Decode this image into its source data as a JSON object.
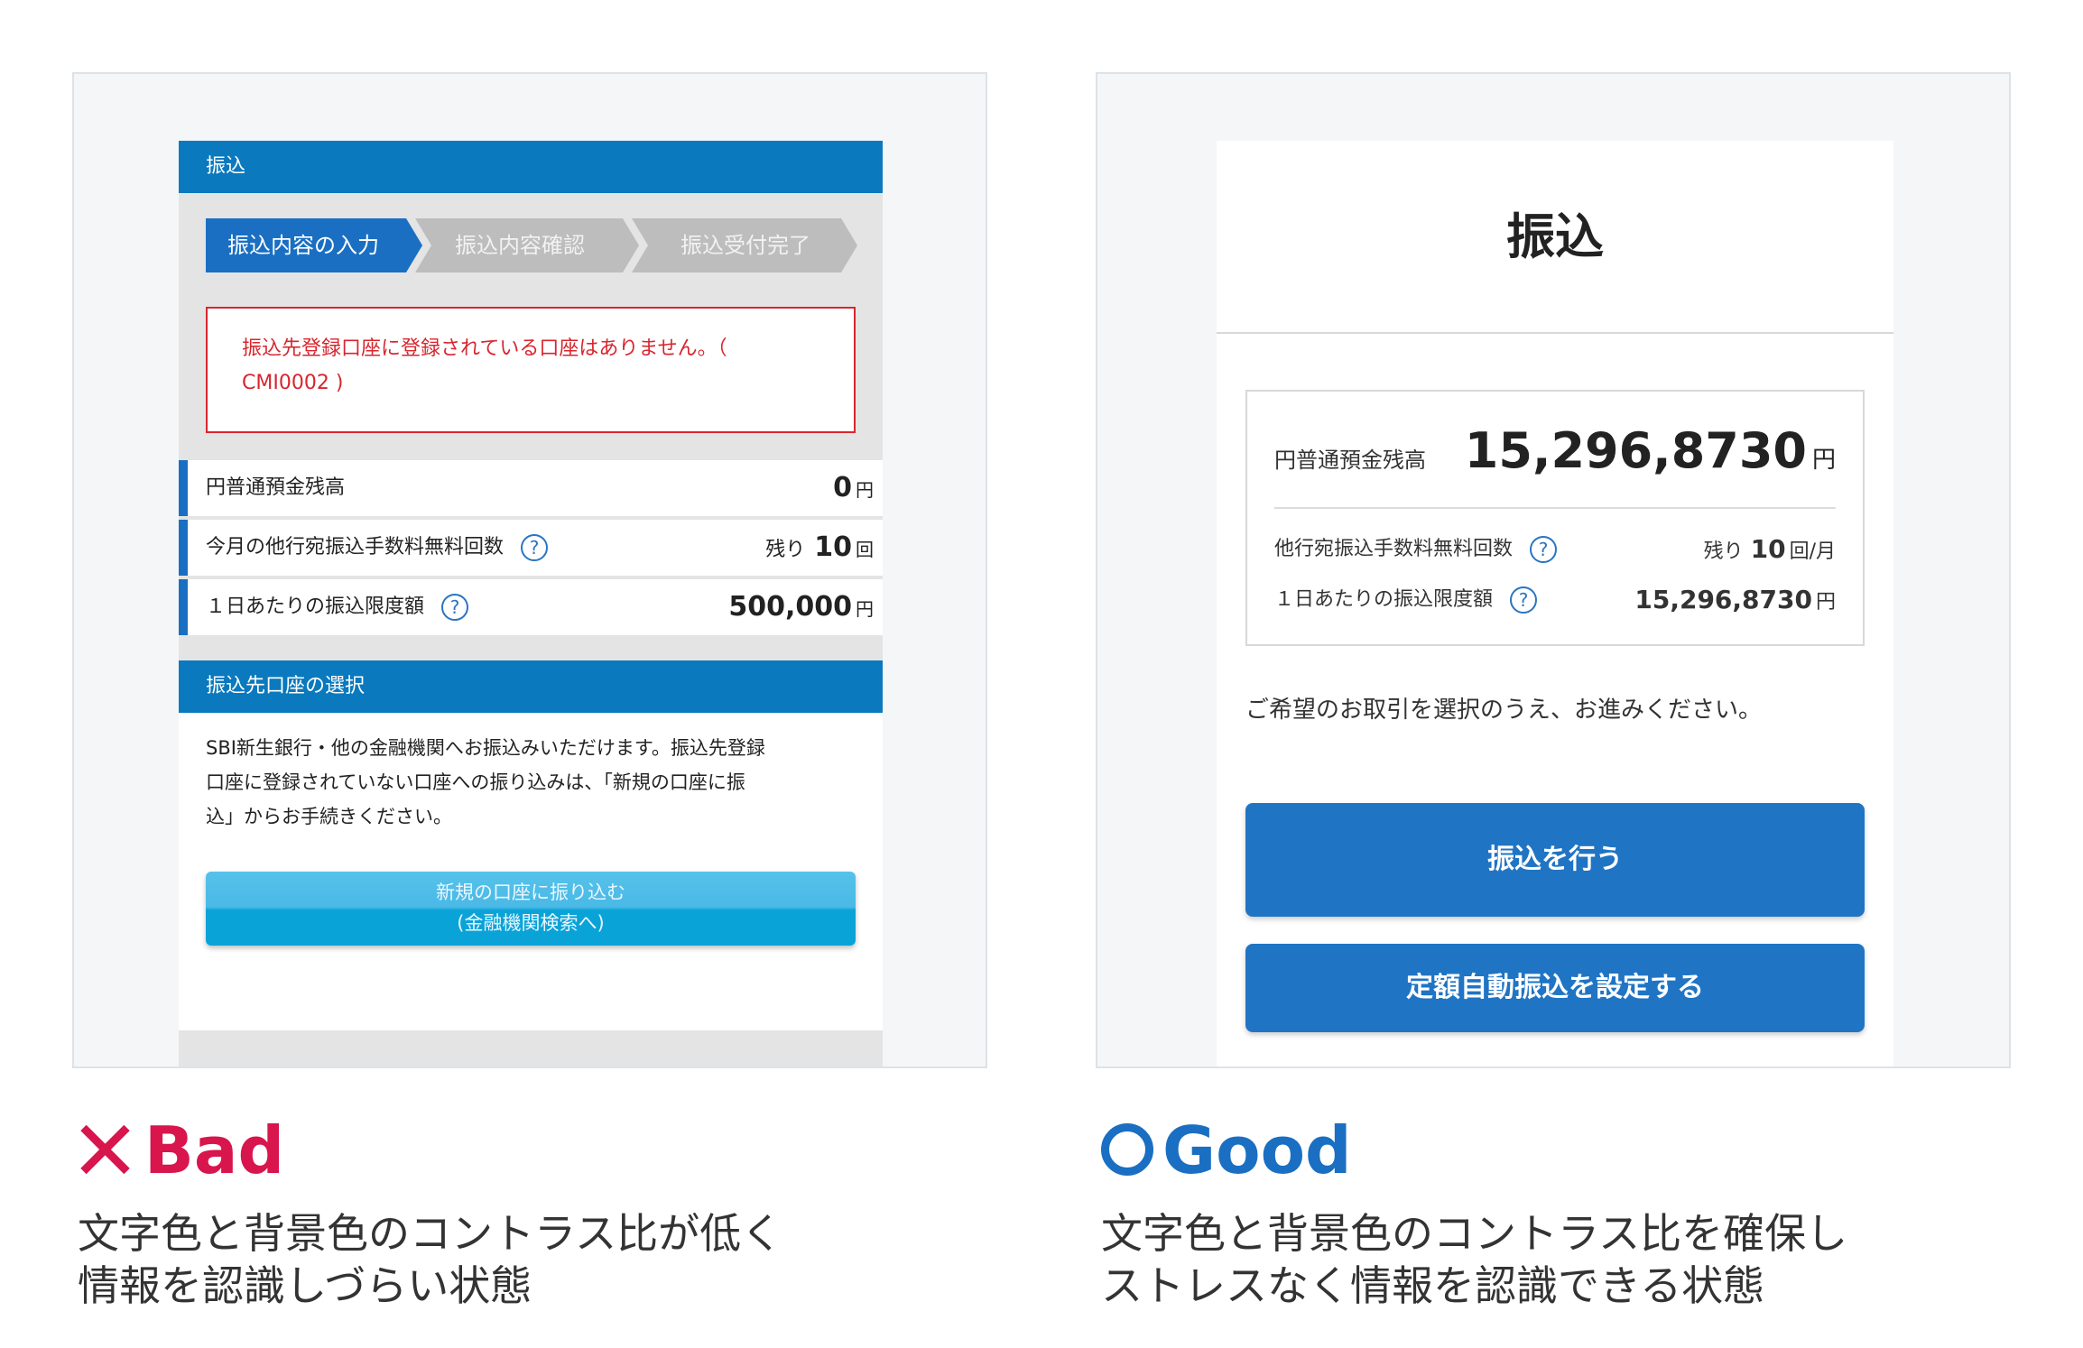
{
  "bad": {
    "header": "振込",
    "steps": [
      "振込内容の入力",
      "振込内容確認",
      "振込受付完了"
    ],
    "error_line1": "振込先登録口座に登録されている口座はありません。（",
    "error_line2": "CMI0002 )",
    "rows": [
      {
        "label": "円普通預金残高",
        "prefix": "",
        "value": "0",
        "unit": "円"
      },
      {
        "label": "今月の他行宛振込手数料無料回数",
        "prefix": "残り",
        "value": "10",
        "unit": "回"
      },
      {
        "label": "１日あたりの振込限度額",
        "prefix": "",
        "value": "500,000",
        "unit": "円"
      }
    ],
    "help_glyph": "?",
    "section_header": "振込先口座の選択",
    "desc_line1": "SBI新生銀行・他の金融機関へお振込みいただけます。振込先登録",
    "desc_line2": "口座に登録されていない口座への振り込みは、「新規の口座に振",
    "desc_line3": "込」からお手続きください。",
    "button_line1": "新規の口座に振り込む",
    "button_line2": "(金融機関検索へ)"
  },
  "good": {
    "title": "振込",
    "balance_label": "円普通預金残高",
    "balance_value": "15,296,8730",
    "balance_unit": "円",
    "fee_label": "他行宛振込手数料無料回数",
    "fee_prefix": "残り",
    "fee_value": "10",
    "fee_unit": "回/月",
    "limit_label": "１日あたりの振込限度額",
    "limit_value": "15,296,8730",
    "limit_unit": "円",
    "help_glyph": "?",
    "instruction": "ご希望のお取引を選択のうえ、お進みください。",
    "button1": "振込を行う",
    "button2": "定額自動振込を設定する"
  },
  "captions": {
    "bad_title": "Bad",
    "bad_line1": "文字色と背景色のコントラス比が低く",
    "bad_line2": "情報を認識しづらい状態",
    "good_title": "Good",
    "good_line1": "文字色と背景色のコントラス比を確保し",
    "good_line2": "ストレスなく情報を認識できる状態"
  },
  "colors": {
    "bad_accent": "#d8154d",
    "good_accent": "#1a6fc2",
    "bad_header": "#0a79bd",
    "good_button": "#2074c4",
    "error_red": "#d7262e"
  },
  "icons": {
    "bad_mark": "cross-icon",
    "good_mark": "circle-icon",
    "help": "question-circle-icon"
  }
}
